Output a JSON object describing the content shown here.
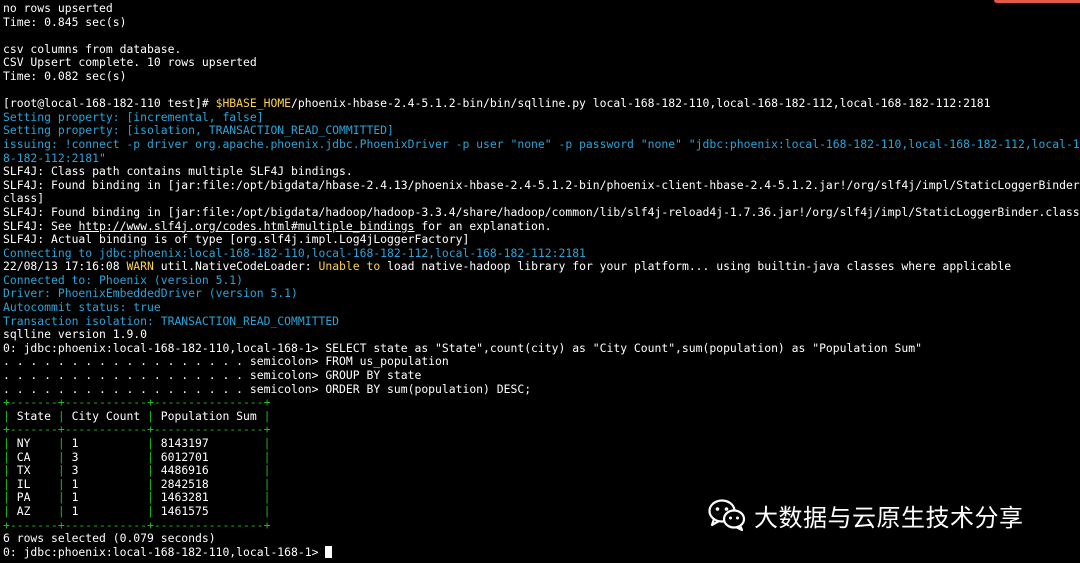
{
  "terminal": {
    "lines": [
      {
        "segs": [
          {
            "t": "no rows upserted",
            "c": "w"
          }
        ]
      },
      {
        "segs": [
          {
            "t": "Time: 0.845 sec(s)",
            "c": "w"
          }
        ]
      },
      {
        "segs": []
      },
      {
        "segs": [
          {
            "t": "csv columns from database.",
            "c": "w"
          }
        ]
      },
      {
        "segs": [
          {
            "t": "CSV Upsert complete. 10 rows upserted",
            "c": "w"
          }
        ]
      },
      {
        "segs": [
          {
            "t": "Time: 0.082 sec(s)",
            "c": "w"
          }
        ]
      },
      {
        "segs": []
      },
      {
        "segs": [
          {
            "t": "[root@local-168-182-110 test]# ",
            "c": "w"
          },
          {
            "t": "$HBASE_HOME",
            "c": "y"
          },
          {
            "t": "/phoenix-hbase-2.4-5.1.2-bin/bin/sqlline.py local-168-182-110,local-168-182-112,local-168-182-112:2181",
            "c": "w"
          }
        ]
      },
      {
        "segs": [
          {
            "t": "Setting property: [incremental, false]",
            "c": "c"
          }
        ]
      },
      {
        "segs": [
          {
            "t": "Setting property: [isolation, TRANSACTION_READ_COMMITTED]",
            "c": "c"
          }
        ]
      },
      {
        "segs": [
          {
            "t": "issuing: !connect -p driver org.apache.phoenix.jdbc.PhoenixDriver -p user \"none\" -p password \"none\" \"jdbc:phoenix:local-168-182-110,local-168-182-112,local-16",
            "c": "c"
          }
        ]
      },
      {
        "segs": [
          {
            "t": "8-182-112:2181\"",
            "c": "c"
          }
        ]
      },
      {
        "segs": [
          {
            "t": "SLF4J: Class path contains multiple SLF4J bindings.",
            "c": "w"
          }
        ]
      },
      {
        "segs": [
          {
            "t": "SLF4J: Found binding in [jar:file:/opt/bigdata/hbase-2.4.13/phoenix-hbase-2.4-5.1.2-bin/phoenix-client-hbase-2.4-5.1.2.jar!/org/slf4j/impl/StaticLoggerBinder.",
            "c": "w"
          }
        ]
      },
      {
        "segs": [
          {
            "t": "class]",
            "c": "w"
          }
        ]
      },
      {
        "segs": [
          {
            "t": "SLF4J: Found binding in [jar:file:/opt/bigdata/hadoop/hadoop-3.3.4/share/hadoop/common/lib/slf4j-reload4j-1.7.36.jar!/org/slf4j/impl/StaticLoggerBinder.class]",
            "c": "w"
          }
        ]
      },
      {
        "segs": [
          {
            "t": "SLF4J: See ",
            "c": "w"
          },
          {
            "t": "http://www.slf4j.org/codes.html#multiple_bindings",
            "c": "w",
            "u": true
          },
          {
            "t": " for an explanation.",
            "c": "w"
          }
        ]
      },
      {
        "segs": [
          {
            "t": "SLF4J: Actual binding is of type [org.slf4j.impl.Log4jLoggerFactory]",
            "c": "w"
          }
        ]
      },
      {
        "segs": [
          {
            "t": "Connecting to jdbc:phoenix:local-168-182-110,local-168-182-112,local-168-182-112:2181",
            "c": "c"
          }
        ]
      },
      {
        "segs": [
          {
            "t": "22/08/13 17:16:08 ",
            "c": "w"
          },
          {
            "t": "WARN",
            "c": "y"
          },
          {
            "t": " util.NativeCodeLoader: ",
            "c": "w"
          },
          {
            "t": "Unable to",
            "c": "y"
          },
          {
            "t": " load native-hadoop library for your platform... using builtin-java classes where applicable",
            "c": "w"
          }
        ]
      },
      {
        "segs": [
          {
            "t": "Connected to: Phoenix (version 5.1)",
            "c": "c"
          }
        ]
      },
      {
        "segs": [
          {
            "t": "Driver: PhoenixEmbeddedDriver (version 5.1)",
            "c": "c"
          }
        ]
      },
      {
        "segs": [
          {
            "t": "Autocommit status: true",
            "c": "c"
          }
        ]
      },
      {
        "segs": [
          {
            "t": "Transaction isolation: TRANSACTION_READ_COMMITTED",
            "c": "c"
          }
        ]
      },
      {
        "segs": [
          {
            "t": "sqlline version 1.9.0",
            "c": "w"
          }
        ]
      },
      {
        "segs": [
          {
            "t": "0: jdbc:phoenix:local-168-182-110,local-168-1> SELECT state as \"State\",count(city) as \"City Count\",sum(population) as \"Population Sum\"",
            "c": "w"
          }
        ]
      },
      {
        "segs": [
          {
            "t": ". . . . . . . . . . . . . . . . . . semicolon> FROM us_population",
            "c": "w"
          }
        ]
      },
      {
        "segs": [
          {
            "t": ". . . . . . . . . . . . . . . . . . semicolon> GROUP BY state",
            "c": "w"
          }
        ]
      },
      {
        "segs": [
          {
            "t": ". . . . . . . . . . . . . . . . . . semicolon> ORDER BY sum(population) DESC;",
            "c": "w"
          }
        ]
      },
      {
        "segs": [
          {
            "t": "+-------+------------+----------------+",
            "c": "g"
          }
        ]
      },
      {
        "segs": [
          {
            "t": "| ",
            "c": "g"
          },
          {
            "t": "State",
            "c": "w"
          },
          {
            "t": " | ",
            "c": "g"
          },
          {
            "t": "City Count",
            "c": "w"
          },
          {
            "t": " | ",
            "c": "g"
          },
          {
            "t": "Population Sum",
            "c": "w"
          },
          {
            "t": " |",
            "c": "g"
          }
        ]
      },
      {
        "segs": [
          {
            "t": "+-------+------------+----------------+",
            "c": "g"
          }
        ]
      },
      {
        "segs": [
          {
            "t": "| ",
            "c": "g"
          },
          {
            "t": "NY   ",
            "c": "w"
          },
          {
            "t": " | ",
            "c": "g"
          },
          {
            "t": "1         ",
            "c": "w"
          },
          {
            "t": " | ",
            "c": "g"
          },
          {
            "t": "8143197       ",
            "c": "w"
          },
          {
            "t": " |",
            "c": "g"
          }
        ]
      },
      {
        "segs": [
          {
            "t": "| ",
            "c": "g"
          },
          {
            "t": "CA   ",
            "c": "w"
          },
          {
            "t": " | ",
            "c": "g"
          },
          {
            "t": "3         ",
            "c": "w"
          },
          {
            "t": " | ",
            "c": "g"
          },
          {
            "t": "6012701       ",
            "c": "w"
          },
          {
            "t": " |",
            "c": "g"
          }
        ]
      },
      {
        "segs": [
          {
            "t": "| ",
            "c": "g"
          },
          {
            "t": "TX   ",
            "c": "w"
          },
          {
            "t": " | ",
            "c": "g"
          },
          {
            "t": "3         ",
            "c": "w"
          },
          {
            "t": " | ",
            "c": "g"
          },
          {
            "t": "4486916       ",
            "c": "w"
          },
          {
            "t": " |",
            "c": "g"
          }
        ]
      },
      {
        "segs": [
          {
            "t": "| ",
            "c": "g"
          },
          {
            "t": "IL   ",
            "c": "w"
          },
          {
            "t": " | ",
            "c": "g"
          },
          {
            "t": "1         ",
            "c": "w"
          },
          {
            "t": " | ",
            "c": "g"
          },
          {
            "t": "2842518       ",
            "c": "w"
          },
          {
            "t": " |",
            "c": "g"
          }
        ]
      },
      {
        "segs": [
          {
            "t": "| ",
            "c": "g"
          },
          {
            "t": "PA   ",
            "c": "w"
          },
          {
            "t": " | ",
            "c": "g"
          },
          {
            "t": "1         ",
            "c": "w"
          },
          {
            "t": " | ",
            "c": "g"
          },
          {
            "t": "1463281       ",
            "c": "w"
          },
          {
            "t": " |",
            "c": "g"
          }
        ]
      },
      {
        "segs": [
          {
            "t": "| ",
            "c": "g"
          },
          {
            "t": "AZ   ",
            "c": "w"
          },
          {
            "t": " | ",
            "c": "g"
          },
          {
            "t": "1         ",
            "c": "w"
          },
          {
            "t": " | ",
            "c": "g"
          },
          {
            "t": "1461575       ",
            "c": "w"
          },
          {
            "t": " |",
            "c": "g"
          }
        ]
      },
      {
        "segs": [
          {
            "t": "+-------+------------+----------------+",
            "c": "g"
          }
        ]
      },
      {
        "segs": [
          {
            "t": "6 rows selected (0.079 seconds)",
            "c": "w"
          }
        ]
      },
      {
        "segs": [
          {
            "t": "0: jdbc:phoenix:local-168-182-110,local-168-1> ",
            "c": "w"
          }
        ],
        "cursor": true
      }
    ]
  },
  "watermark": {
    "icon": "wechat-icon",
    "text": "大数据与云原生技术分享"
  },
  "colors": {
    "background": "#000000",
    "text": "#ffffff",
    "info": "#2aa3d8",
    "warn": "#ffd24a",
    "table_border": "#18c018",
    "top_mark": "#e05a45"
  }
}
